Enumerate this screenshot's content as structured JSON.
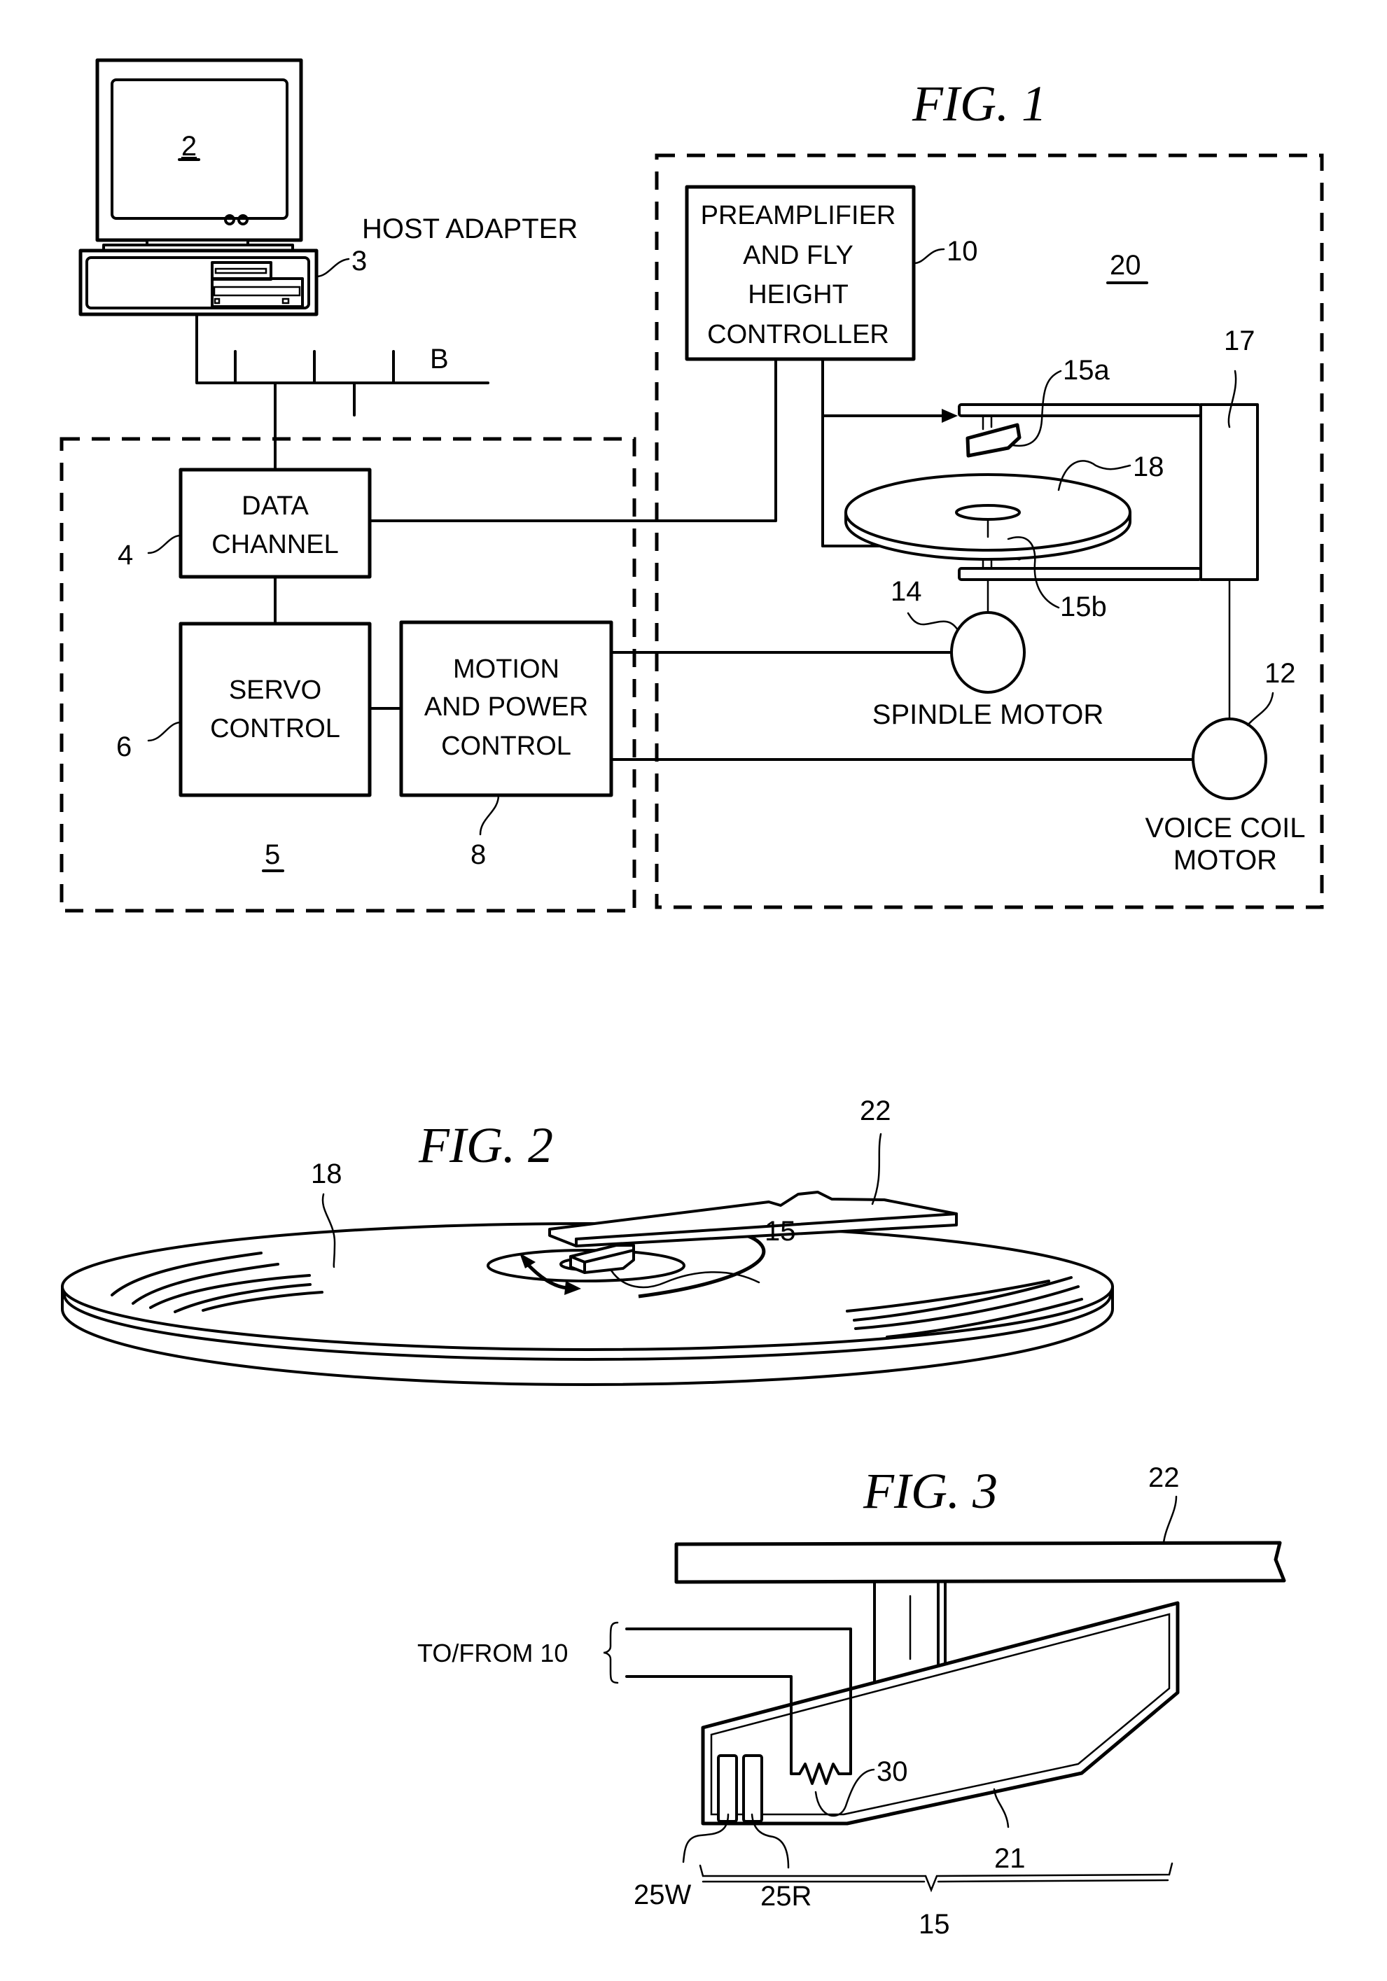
{
  "figures": {
    "fig1": {
      "title": "FIG. 1",
      "host_label": "2",
      "host_adapter_label": "HOST ADAPTER",
      "host_adapter_ref": "3",
      "bus_label": "B",
      "controller_group_ref": "5",
      "drive_group_ref": "20",
      "blocks": {
        "data_channel": {
          "lines": [
            "DATA",
            "CHANNEL"
          ],
          "ref": "4"
        },
        "servo_control": {
          "lines": [
            "SERVO",
            "CONTROL"
          ],
          "ref": "6"
        },
        "motion_power": {
          "lines": [
            "MOTION",
            "AND POWER",
            "CONTROL"
          ],
          "ref": "8"
        },
        "preamp": {
          "lines": [
            "PREAMPLIFIER",
            "AND FLY",
            "HEIGHT",
            "CONTROLLER"
          ],
          "ref": "10"
        }
      },
      "refs": {
        "head_a": "15a",
        "head_b": "15b",
        "disk": "18",
        "actuator": "17",
        "spindle": "14",
        "vcm": "12"
      },
      "spindle_label": "SPINDLE MOTOR",
      "vcm_label_lines": [
        "VOICE COIL",
        "MOTOR"
      ]
    },
    "fig2": {
      "title": "FIG. 2",
      "refs": {
        "disk": "18",
        "arm": "22",
        "head": "15"
      }
    },
    "fig3": {
      "title": "FIG. 3",
      "refs": {
        "arm": "22",
        "heater": "30",
        "slider": "21",
        "write": "25W",
        "read": "25R",
        "head": "15"
      },
      "to_from_label": "TO/FROM 10"
    }
  }
}
